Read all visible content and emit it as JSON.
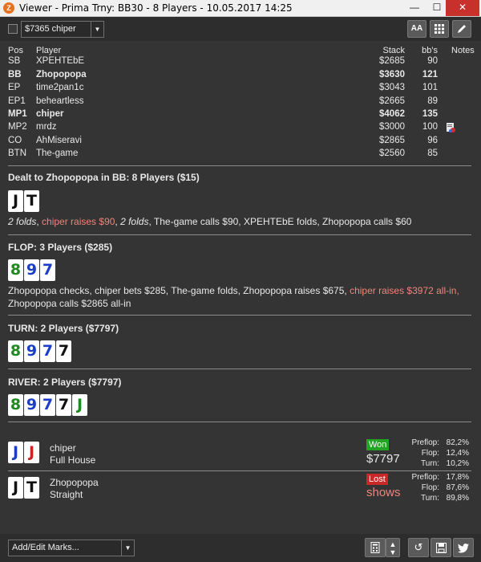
{
  "window": {
    "title": "Viewer - Prima Trny: BB30 - 8 Players - 10.05.2017 14:25",
    "app_icon": "Z",
    "min_glyph": "—",
    "max_glyph": "☐",
    "close_glyph": "✕"
  },
  "toolbar": {
    "player_select": "$7365 chiper",
    "font_button": "AA"
  },
  "table": {
    "headers": {
      "pos": "Pos",
      "player": "Player",
      "stack": "Stack",
      "bbs": "bb's",
      "notes": "Notes"
    },
    "rows": [
      {
        "pos": "SB",
        "player": "XPEHTEbE",
        "stack": "$2685",
        "bbs": "90",
        "bold": false
      },
      {
        "pos": "BB",
        "player": "Zhopopopa",
        "stack": "$3630",
        "bbs": "121",
        "bold": true
      },
      {
        "pos": "EP",
        "player": "time2pan1c",
        "stack": "$3043",
        "bbs": "101",
        "bold": false
      },
      {
        "pos": "EP1",
        "player": "beheartless",
        "stack": "$2665",
        "bbs": "89",
        "bold": false
      },
      {
        "pos": "MP1",
        "player": "chiper",
        "stack": "$4062",
        "bbs": "135",
        "bold": true
      },
      {
        "pos": "MP2",
        "player": "mrdz",
        "stack": "$3000",
        "bbs": "100",
        "bold": false
      },
      {
        "pos": "CO",
        "player": "AhMiseravi",
        "stack": "$2865",
        "bbs": "96",
        "bold": false
      },
      {
        "pos": "BTN",
        "player": "The-game",
        "stack": "$2560",
        "bbs": "85",
        "bold": false
      }
    ]
  },
  "preflop": {
    "heading": "Dealt to Zhopopopa in BB: 8 Players ($15)",
    "cards": [
      "J",
      "T"
    ],
    "action_folds1": "2 folds",
    "action_sep1": ", ",
    "action_raise": "chiper raises $90",
    "action_sep2": ", ",
    "action_folds2": "2 folds",
    "action_rest": ", The-game calls $90, XPEHTEbE folds, Zhopopopa calls $60"
  },
  "flop": {
    "heading": "FLOP: 3 Players ($285)",
    "cards": [
      "8",
      "9",
      "7"
    ],
    "action_part1": "Zhopopopa checks, chiper bets $285, The-game folds, Zhopopopa raises $675, ",
    "action_raise": "chiper raises $3972 all-in,",
    "action_part2": "Zhopopopa calls $2865 all-in"
  },
  "turn": {
    "heading": "TURN: 2 Players ($7797)",
    "cards": [
      "8",
      "9",
      "7",
      "7"
    ]
  },
  "river": {
    "heading": "RIVER: 2 Players ($7797)",
    "cards": [
      "8",
      "9",
      "7",
      "7",
      "J"
    ]
  },
  "results": [
    {
      "cards": [
        "J",
        "J"
      ],
      "player": "chiper",
      "hand": "Full House",
      "badge": "Won",
      "amount": "$7797",
      "preflop_label": "Preflop:",
      "preflop": "82,2%",
      "flop_label": "Flop:",
      "flop": "12,4%",
      "turn_label": "Turn:",
      "turn": "10,2%"
    },
    {
      "cards": [
        "J",
        "T"
      ],
      "player": "Zhopopopa",
      "hand": "Straight",
      "badge": "Lost",
      "amount": "shows",
      "preflop_label": "Preflop:",
      "preflop": "17,8%",
      "flop_label": "Flop:",
      "flop": "87,6%",
      "turn_label": "Turn:",
      "turn": "89,8%"
    }
  ],
  "bottom": {
    "marks_select": "Add/Edit Marks..."
  },
  "colors": {
    "raise_text": "#f0847a",
    "won": "#25a325",
    "lost": "#c72828"
  }
}
